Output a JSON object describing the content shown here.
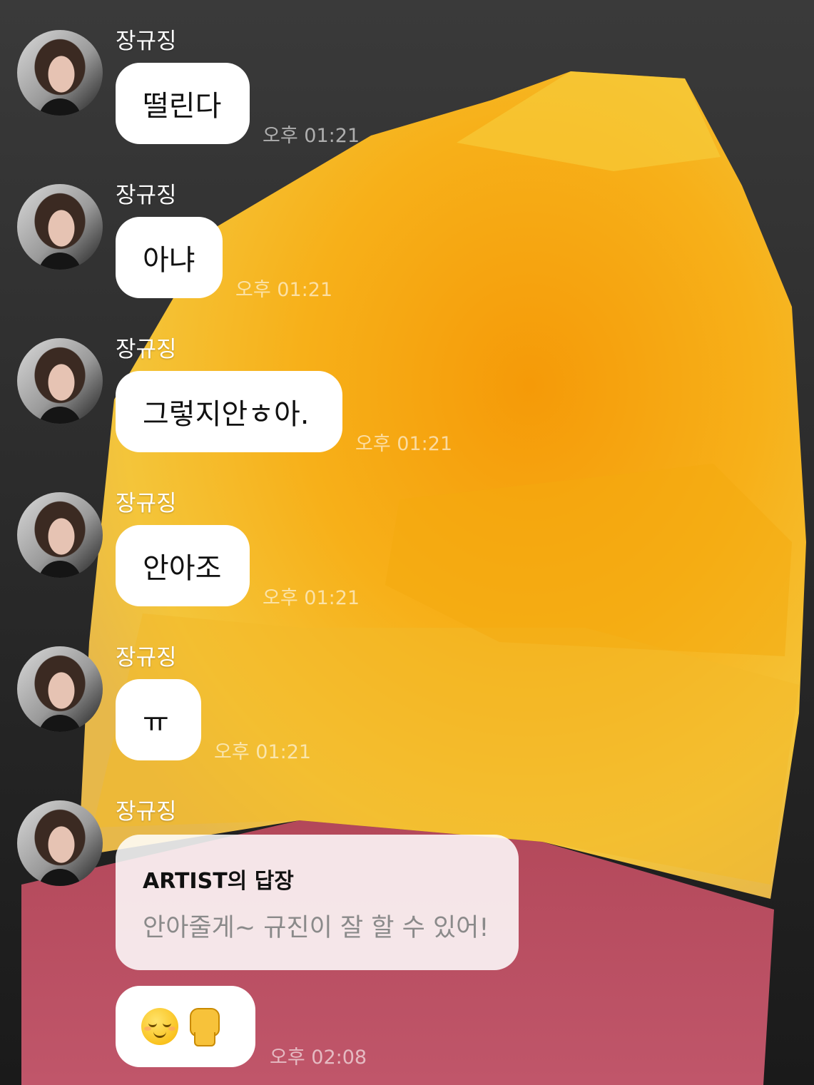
{
  "colors": {
    "bubble": "#ffffff",
    "name_text": "#ffffff",
    "time_text": "#bfbfbf",
    "reply_title": "#111111",
    "reply_text": "#8a8a8a"
  },
  "messages": [
    {
      "sender": "장규징",
      "text": "떨린다",
      "time": "오후 01:21"
    },
    {
      "sender": "장규징",
      "text": "아냐",
      "time": "오후 01:21"
    },
    {
      "sender": "장규징",
      "text": "그렇지안ㅎ아.",
      "time": "오후 01:21"
    },
    {
      "sender": "장규징",
      "text": "안아조",
      "time": "오후 01:21"
    },
    {
      "sender": "장규징",
      "text": "ㅠ",
      "time": "오후 01:21"
    }
  ],
  "last": {
    "sender": "장규징",
    "reply_title": "ARTIST의 답장",
    "reply_text": "안아줄게~ 규진이 잘 할 수 있어!",
    "emoji_icons": [
      "relieved-face-icon",
      "raised-fist-icon"
    ],
    "time": "오후 02:08"
  }
}
